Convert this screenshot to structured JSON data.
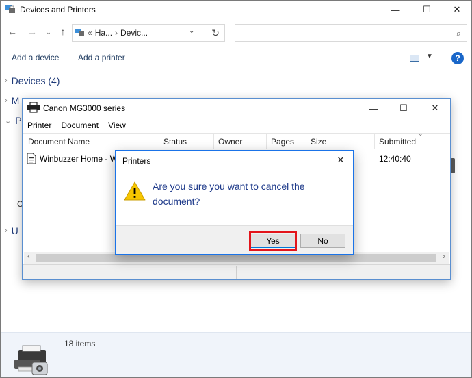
{
  "main_window": {
    "title": "Devices and Printers",
    "controls": {
      "minimize": "—",
      "maximize": "☐",
      "close": "✕"
    },
    "address": {
      "chevrons": "«",
      "segments": [
        "Ha...",
        "Devic..."
      ],
      "separator": "›"
    },
    "search": {
      "placeholder": ""
    },
    "commands": {
      "add_device": "Add a device",
      "add_printer": "Add a printer"
    },
    "sections": {
      "devices": "Devices (4)",
      "multimedia_fragment": "M",
      "printers_fragment": "Pr",
      "unspecified_fragment": "U"
    },
    "left_fragment_c": "C",
    "status": {
      "items": "18 items"
    }
  },
  "queue_window": {
    "title": "Canon MG3000 series",
    "controls": {
      "minimize": "—",
      "maximize": "☐",
      "close": "✕"
    },
    "menu": [
      "Printer",
      "Document",
      "View"
    ],
    "columns": [
      "Document Name",
      "Status",
      "Owner",
      "Pages",
      "Size",
      "Submitted"
    ],
    "rows": [
      {
        "document": "Winbuzzer Home - W",
        "submitted": "12:40:40"
      }
    ]
  },
  "dialog": {
    "title": "Printers",
    "message": "Are you sure you want to cancel the document?",
    "yes_label": "Yes",
    "no_label": "No",
    "highlight_color": "#e3141b"
  },
  "colors": {
    "accent": "#1a73e8",
    "message_text": "#1e3a8a",
    "section_text": "#1e3a78"
  }
}
